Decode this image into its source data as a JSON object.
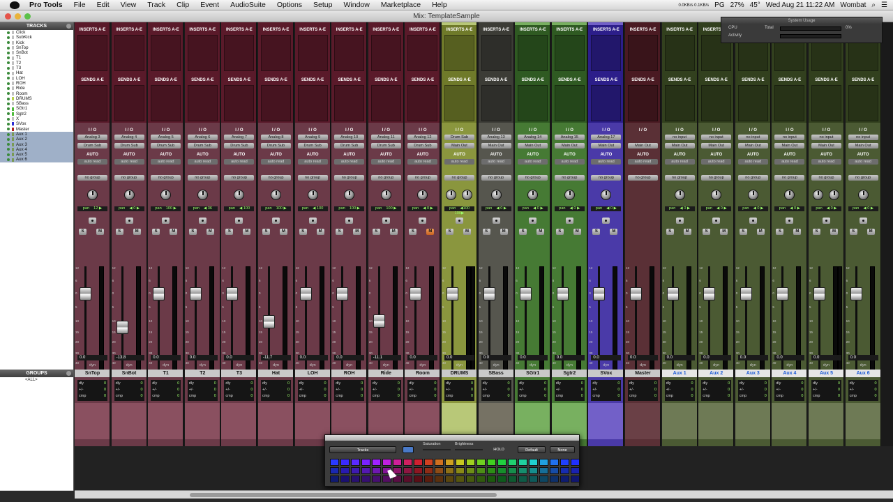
{
  "menubar": {
    "items": [
      "Pro Tools",
      "File",
      "Edit",
      "View",
      "Track",
      "Clip",
      "Event",
      "AudioSuite",
      "Options",
      "Setup",
      "Window",
      "Marketplace",
      "Help"
    ],
    "status": {
      "net": "0.0KB/s 0.1KB/s",
      "battery": "27%",
      "temp": "45°",
      "input": "PG",
      "datetime": "Wed Aug 21  11:22 AM",
      "user": "Wombat"
    }
  },
  "window": {
    "title": "Mix: TemplateSample"
  },
  "left": {
    "tracks_header": "TRACKS",
    "groups_header": "GROUPS",
    "group_all": "<ALL>",
    "tracks": [
      {
        "name": "Click",
        "color": "#c0c0c0",
        "sel": false
      },
      {
        "name": "SubKick",
        "color": "#c0c0c0",
        "sel": false
      },
      {
        "name": "Kick",
        "color": "#c0c0c0",
        "sel": false
      },
      {
        "name": "SnTop",
        "color": "#c0c0c0",
        "sel": false
      },
      {
        "name": "SnBot",
        "color": "#c0c0c0",
        "sel": false
      },
      {
        "name": "T1",
        "color": "#c0c0c0",
        "sel": false
      },
      {
        "name": "T2",
        "color": "#c0c0c0",
        "sel": false
      },
      {
        "name": "T3",
        "color": "#c0c0c0",
        "sel": false
      },
      {
        "name": "Hat",
        "color": "#c0c0c0",
        "sel": false
      },
      {
        "name": "LOH",
        "color": "#c0c0c0",
        "sel": false
      },
      {
        "name": "ROH",
        "color": "#c0c0c0",
        "sel": false
      },
      {
        "name": "Ride",
        "color": "#c0c0c0",
        "sel": false
      },
      {
        "name": "Room",
        "color": "#c0c0c0",
        "sel": false
      },
      {
        "name": "DRUMS",
        "color": "#b7d24a",
        "sel": false
      },
      {
        "name": "SBass",
        "color": "#c0c0c0",
        "sel": false
      },
      {
        "name": "SGtr1",
        "color": "#4dbb3a",
        "sel": false
      },
      {
        "name": "Sgtr2",
        "color": "#4dbb3a",
        "sel": false
      },
      {
        "name": "X",
        "color": "#c0c0c0",
        "sel": false
      },
      {
        "name": "SVox",
        "color": "#2a2ad4",
        "sel": false
      },
      {
        "name": "Master",
        "color": "#b02020",
        "sel": false
      },
      {
        "name": "Aux 1",
        "color": "#7a9a55",
        "sel": true
      },
      {
        "name": "Aux 2",
        "color": "#7a9a55",
        "sel": true
      },
      {
        "name": "Aux 3",
        "color": "#7a9a55",
        "sel": true
      },
      {
        "name": "Aux 4",
        "color": "#7a9a55",
        "sel": true
      },
      {
        "name": "Aux 5",
        "color": "#7a9a55",
        "sel": true
      },
      {
        "name": "Aux 6",
        "color": "#7a9a55",
        "sel": true
      }
    ]
  },
  "labels": {
    "inserts": "INSERTS A-E",
    "sends": "SENDS A-E",
    "io": "I / O",
    "auto": "AUTO",
    "auto_mode": "auto read",
    "group": "no group",
    "pan": "pan",
    "dyn": "dyn",
    "dly": "dly",
    "pm": "+/-",
    "cmp": "cmp",
    "zero": "0",
    "s": "S",
    "m": "M"
  },
  "strips": [
    {
      "name": "SnTop",
      "in": "Analog 3",
      "out": "Drum Sub",
      "pan": "12 ▶",
      "vol": "0.0",
      "fader": 0.78,
      "top": "#5a1a2a",
      "body": "#6b3a48",
      "cm": "#8a5060",
      "aux": false,
      "stereo": false
    },
    {
      "name": "SnBot",
      "in": "Analog 4",
      "out": "Drum Sub",
      "pan": "◀ 0 ▶",
      "vol": "-13.8",
      "fader": 0.42,
      "top": "#5a1a2a",
      "body": "#6b3a48",
      "cm": "#8a5060",
      "aux": false,
      "stereo": false
    },
    {
      "name": "T1",
      "in": "Analog 5",
      "out": "Drum Sub",
      "pan": "100 ▶",
      "vol": "0.0",
      "fader": 0.78,
      "top": "#5a1a2a",
      "body": "#6b3a48",
      "cm": "#8a5060",
      "aux": false,
      "stereo": false
    },
    {
      "name": "T2",
      "in": "Analog 6",
      "out": "Drum Sub",
      "pan": "◀ 36",
      "vol": "0.0",
      "fader": 0.78,
      "top": "#5a1a2a",
      "body": "#6b3a48",
      "cm": "#8a5060",
      "aux": false,
      "stereo": false
    },
    {
      "name": "T3",
      "in": "Analog 7",
      "out": "Drum Sub",
      "pan": "◀ 100",
      "vol": "0.0",
      "fader": 0.78,
      "top": "#5a1a2a",
      "body": "#6b3a48",
      "cm": "#8a5060",
      "aux": false,
      "stereo": false
    },
    {
      "name": "Hat",
      "in": "Analog 8",
      "out": "Drum Sub",
      "pan": "100 ▶",
      "vol": "-11.7",
      "fader": 0.48,
      "top": "#5a1a2a",
      "body": "#6b3a48",
      "cm": "#8a5060",
      "aux": false,
      "stereo": false
    },
    {
      "name": "LOH",
      "in": "Analog 9",
      "out": "Drum Sub",
      "pan": "◀ 100",
      "vol": "0.0",
      "fader": 0.78,
      "top": "#5a1a2a",
      "body": "#6b3a48",
      "cm": "#8a5060",
      "aux": false,
      "stereo": false
    },
    {
      "name": "ROH",
      "in": "Analog 10",
      "out": "Drum Sub",
      "pan": "100 ▶",
      "vol": "0.0",
      "fader": 0.78,
      "top": "#5a1a2a",
      "body": "#6b3a48",
      "cm": "#8a5060",
      "aux": false,
      "stereo": false
    },
    {
      "name": "Ride",
      "in": "Analog 11",
      "out": "Drum Sub",
      "pan": "100 ▶",
      "vol": "-11.1",
      "fader": 0.49,
      "top": "#5a1a2a",
      "body": "#6b3a48",
      "cm": "#8a5060",
      "aux": false,
      "stereo": false
    },
    {
      "name": "Room",
      "in": "Analog 12",
      "out": "Drum Sub",
      "pan": "◀ 0 ▶",
      "vol": "0.0",
      "fader": 0.78,
      "top": "#5a1a2a",
      "body": "#6b3a48",
      "cm": "#8a5060",
      "aux": false,
      "stereo": false,
      "mute": true
    },
    {
      "name": "DRUMS",
      "in": "Drum Sub",
      "out": "Main Out",
      "pan": "◀100 100▶",
      "vol": "0.0",
      "fader": 0.78,
      "top": "#6f7a2a",
      "body": "#8a963e",
      "cm": "#b8c878",
      "aux": false,
      "stereo": true
    },
    {
      "name": "SBass",
      "in": "Analog 13",
      "out": "Main Out",
      "pan": "◀ 0 ▶",
      "vol": "0.0",
      "fader": 0.78,
      "top": "#3c3c36",
      "body": "#56564e",
      "cm": "#767264",
      "aux": false,
      "stereo": false
    },
    {
      "name": "SGtr1",
      "in": "Analog 14",
      "out": "Main Out",
      "pan": "◀ 0 ▶",
      "vol": "0.0",
      "fader": 0.78,
      "top": "#2f5a22",
      "body": "#467a34",
      "cm": "#78b060",
      "aux": false,
      "stereo": false
    },
    {
      "name": "Sgtr2",
      "in": "Analog 15",
      "out": "Main Out",
      "pan": "◀ 0 ▶",
      "vol": "0.0",
      "fader": 0.78,
      "top": "#2f5a22",
      "body": "#467a34",
      "cm": "#78b060",
      "aux": false,
      "stereo": false
    },
    {
      "name": "SVox",
      "in": "Analog 17",
      "out": "Main Out",
      "pan": "◀ 0 ▶",
      "vol": "0.0",
      "fader": 0.78,
      "top": "#2c1e8a",
      "body": "#4a3aa8",
      "cm": "#7260c8",
      "aux": false,
      "stereo": false
    },
    {
      "name": "Master",
      "in": "",
      "out": "Main Out",
      "pan": "",
      "vol": "0.0",
      "fader": 0.78,
      "top": "#4a1a22",
      "body": "#5a3036",
      "cm": "#6a4046",
      "aux": false,
      "stereo": false,
      "master": true
    },
    {
      "name": "Aux 1",
      "in": "no input",
      "out": "Main Out",
      "pan": "◀ 0 ▶",
      "vol": "0.0",
      "fader": 0.78,
      "top": "#32401e",
      "body": "#4b5a33",
      "cm": "#6e7a55",
      "aux": true,
      "stereo": false
    },
    {
      "name": "Aux 2",
      "in": "no input",
      "out": "Main Out",
      "pan": "◀ 0 ▶",
      "vol": "0.0",
      "fader": 0.78,
      "top": "#32401e",
      "body": "#4b5a33",
      "cm": "#6e7a55",
      "aux": true,
      "stereo": false
    },
    {
      "name": "Aux 3",
      "in": "no input",
      "out": "Main Out",
      "pan": "◀ 0 ▶",
      "vol": "0.0",
      "fader": 0.78,
      "top": "#32401e",
      "body": "#4b5a33",
      "cm": "#6e7a55",
      "aux": true,
      "stereo": false
    },
    {
      "name": "Aux 4",
      "in": "no input",
      "out": "Main Out",
      "pan": "◀ 0 ▶",
      "vol": "0.0",
      "fader": 0.78,
      "top": "#32401e",
      "body": "#4b5a33",
      "cm": "#6e7a55",
      "aux": true,
      "stereo": false
    },
    {
      "name": "Aux 5",
      "in": "no input",
      "out": "Main Out",
      "pan": "◀ 0 ▶",
      "vol": "0.0",
      "fader": 0.78,
      "top": "#32401e",
      "body": "#4b5a33",
      "cm": "#6e7a55",
      "aux": true,
      "stereo": true
    },
    {
      "name": "Aux 6",
      "in": "no input",
      "out": "Main Out",
      "pan": "◀ 0 ▶",
      "vol": "0.0",
      "fader": 0.78,
      "top": "#32401e",
      "body": "#4b5a33",
      "cm": "#6e7a55",
      "aux": true,
      "stereo": false
    }
  ],
  "system_usage": {
    "title": "System Usage",
    "cpu": "CPU",
    "total": "Total",
    "pct": "0%",
    "activity": "Activity",
    "cpu_level": 0.0
  },
  "color_palette": {
    "tracks": "Tracks",
    "saturation": "Saturation",
    "brightness": "Brightness",
    "hold": "HOLD",
    "default": "Default",
    "none": "None",
    "rows": [
      [
        "#2a3aff",
        "#3a2aff",
        "#5a2aff",
        "#7a22ff",
        "#a022ff",
        "#c020e0",
        "#d0209a",
        "#d02060",
        "#d02030",
        "#d04020",
        "#d07020",
        "#d0a020",
        "#c8c820",
        "#a0d020",
        "#70d020",
        "#40d020",
        "#20d040",
        "#20d070",
        "#20d0a0",
        "#20d0d0",
        "#20a0e0",
        "#2070f0",
        "#2040ff",
        "#2030ff"
      ],
      [
        "#1a28b0",
        "#281ab0",
        "#3e1ab0",
        "#5418b0",
        "#6e18b0",
        "#841698",
        "#8e166a",
        "#8e1642",
        "#8e1622",
        "#8e2c16",
        "#8e4c16",
        "#8e7016",
        "#8a8a16",
        "#6e8e16",
        "#4c8e16",
        "#2c8e16",
        "#168e2c",
        "#168e4c",
        "#168e6e",
        "#168e8e",
        "#166e98",
        "#164ca6",
        "#162cb0",
        "#1a22b0"
      ],
      [
        "#101a70",
        "#1a1070",
        "#281070",
        "#360f70",
        "#460f70",
        "#540e62",
        "#5a0e44",
        "#5a0e2a",
        "#5a0e16",
        "#5a1c0e",
        "#5a300e",
        "#5a460e",
        "#56560e",
        "#465a0e",
        "#305a0e",
        "#1c5a0e",
        "#0e5a1c",
        "#0e5a30",
        "#0e5a46",
        "#0e5a5a",
        "#0e4662",
        "#0e306a",
        "#0e1c70",
        "#101670"
      ]
    ]
  }
}
